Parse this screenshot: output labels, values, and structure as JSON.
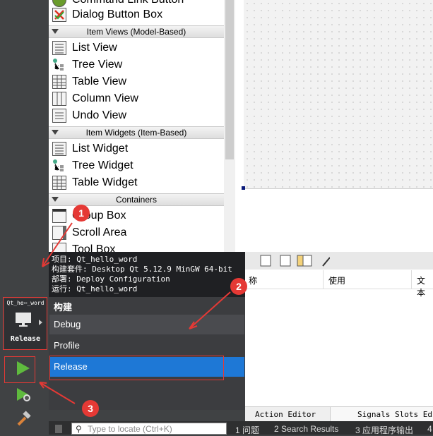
{
  "widget_box": {
    "items_top": [
      {
        "label": "Command Link Button",
        "icon": "command-link-icon"
      },
      {
        "label": "Dialog Button Box",
        "icon": "dialog-button-box-icon"
      }
    ],
    "cat_item_views": "Item Views (Model-Based)",
    "item_views": [
      {
        "label": "List View",
        "icon": "list-view-icon"
      },
      {
        "label": "Tree View",
        "icon": "tree-view-icon"
      },
      {
        "label": "Table View",
        "icon": "table-view-icon"
      },
      {
        "label": "Column View",
        "icon": "column-view-icon"
      },
      {
        "label": "Undo View",
        "icon": "undo-view-icon"
      }
    ],
    "cat_item_widgets": "Item Widgets (Item-Based)",
    "item_widgets": [
      {
        "label": "List Widget",
        "icon": "list-widget-icon"
      },
      {
        "label": "Tree Widget",
        "icon": "tree-widget-icon"
      },
      {
        "label": "Table Widget",
        "icon": "table-widget-icon"
      }
    ],
    "cat_containers": "Containers",
    "containers": [
      {
        "label": "Group Box",
        "icon": "group-box-icon"
      },
      {
        "label": "Scroll Area",
        "icon": "scroll-area-icon"
      },
      {
        "label": "Tool Box",
        "icon": "tool-box-icon"
      }
    ]
  },
  "kit_selector": {
    "project_name": "Qt_he⋯_word",
    "build_config": "Release"
  },
  "popup": {
    "info_lines": [
      "项目: Qt_hello_word",
      "构建套件: Desktop Qt 5.12.9 MinGW 64-bit",
      "部署: Deploy Configuration",
      "运行: Qt_hello_word"
    ],
    "heading": "构建",
    "options": [
      "Debug",
      "Profile",
      "Release"
    ],
    "selected": "Release"
  },
  "table": {
    "headers": [
      "称",
      "使用",
      "文本"
    ]
  },
  "bottom_tabs": {
    "action_editor": "Action Editor",
    "signals_slots": "Signals  Slots Edi"
  },
  "status_bar": {
    "locator_placeholder": "Type to locate (Ctrl+K)",
    "items": [
      "1 问题",
      "2 Search Results",
      "3 应用程序输出",
      "4"
    ]
  },
  "annotations": [
    "1",
    "2",
    "3"
  ],
  "colors": {
    "accent_selected": "#1e78d6",
    "annotation_red": "#e53935",
    "run_green": "#5fba3e"
  }
}
